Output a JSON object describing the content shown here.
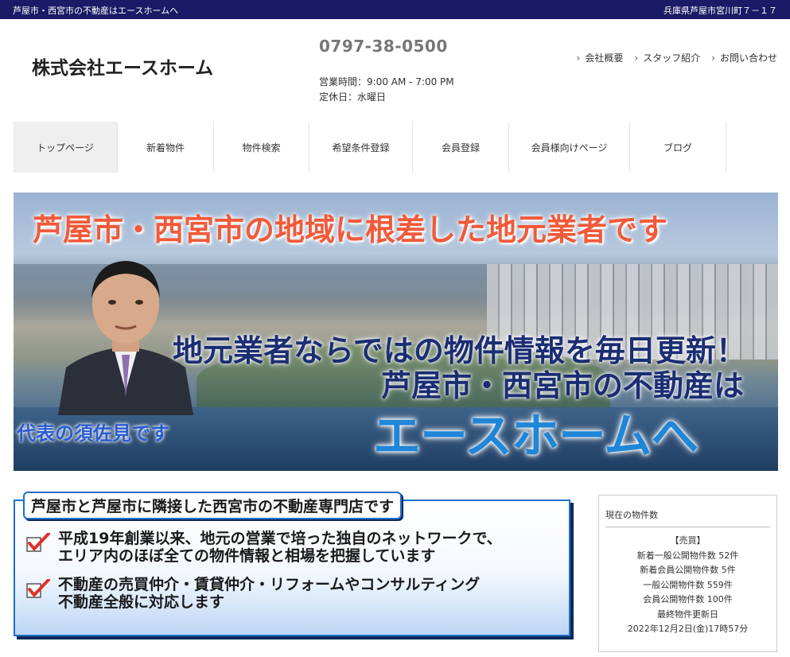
{
  "topbar": {
    "left": "芦屋市・西宮市の不動産はエースホームへ",
    "right": "兵庫県芦屋市宮川町７－１７"
  },
  "header": {
    "company": "株式会社エースホーム",
    "phone": "0797-38-0500",
    "hours": "営業時間：9:00 AM - 7:00 PM",
    "holiday": "定休日：水曜日",
    "links": [
      "会社概要",
      "スタッフ紹介",
      "お問い合わせ"
    ]
  },
  "nav": [
    "トップページ",
    "新着物件",
    "物件検索",
    "希望条件登録",
    "会員登録",
    "会員様向けページ",
    "ブログ"
  ],
  "hero": {
    "headline": "芦屋市・西宮市の地域に根差した地元業者です",
    "line1": "地元業者ならではの物件情報を毎日更新！",
    "line2": "芦屋市・西宮市の不動産は",
    "brand": "エースホームへ",
    "caption": "代表の須佐見です"
  },
  "intro": {
    "title": "芦屋市と芦屋市に隣接した西宮市の不動産専門店です",
    "items": [
      {
        "line1": "平成19年創業以来、地元の営業で培った独自のネットワークで、",
        "line2": "エリア内のほぼ全ての物件情報と相場を把握しています"
      },
      {
        "line1": "不動産の売買仲介・賃貸仲介・リフォームやコンサルティング",
        "line2": "不動産全般に対応します"
      }
    ]
  },
  "sidebar": {
    "title": "現在の物件数",
    "lines": [
      "【売買】",
      "新着一般公開物件数 52件",
      "新着会員公開物件数 5件",
      "一般公開物件数 559件",
      "会員公開物件数 100件",
      "最終物件更新日",
      "2022年12月2日(金)17時57分"
    ]
  },
  "colors": {
    "topbar": "#1a1a66",
    "accent_blue": "#1d6fc8",
    "headline_red": "#f15a3a",
    "check_red": "#e0302a"
  }
}
